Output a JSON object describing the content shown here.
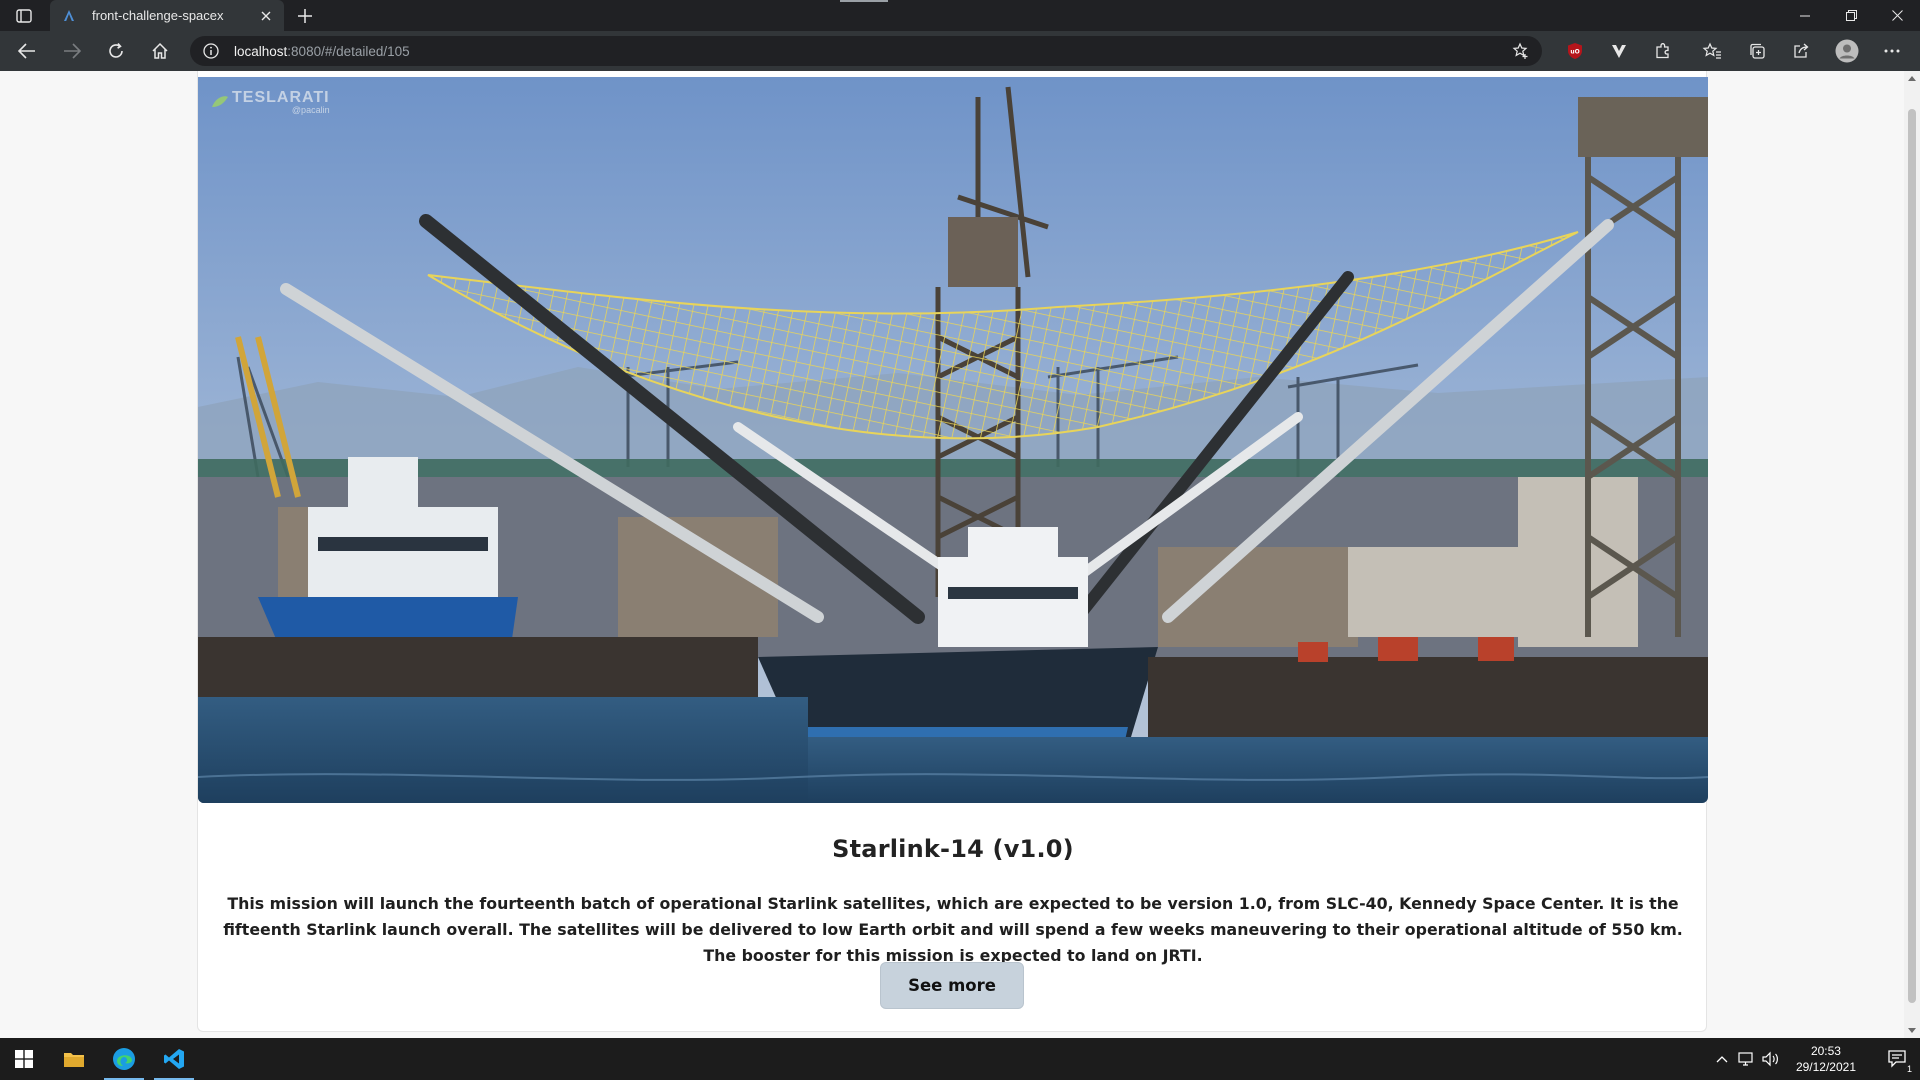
{
  "browser": {
    "tab_title": "front-challenge-spacex",
    "url_host": "localhost",
    "url_path": ":8080/#/detailed/105"
  },
  "page": {
    "hero_watermark_brand": "TESLARATI",
    "hero_watermark_credit": "@pacalin",
    "mission_name": "Starlink-14 (v1.0)",
    "mission_description": "This mission will launch the fourteenth batch of operational Starlink satellites, which are expected to be version 1.0, from SLC-40, Kennedy Space Center. It is the fifteenth Starlink launch overall. The satellites will be delivered to low Earth orbit and will spend a few weeks maneuvering to their operational altitude of 550 km. The booster for this mission is expected to land on JRTI.",
    "see_more_label": "See more"
  },
  "taskbar": {
    "time": "20:53",
    "date": "29/12/2021",
    "notification_count": "1"
  },
  "colors": {
    "tabbar": "#202124",
    "toolbar": "#323639",
    "button_bg": "#c7d2dc",
    "taskbar": "#1c1c1c"
  }
}
